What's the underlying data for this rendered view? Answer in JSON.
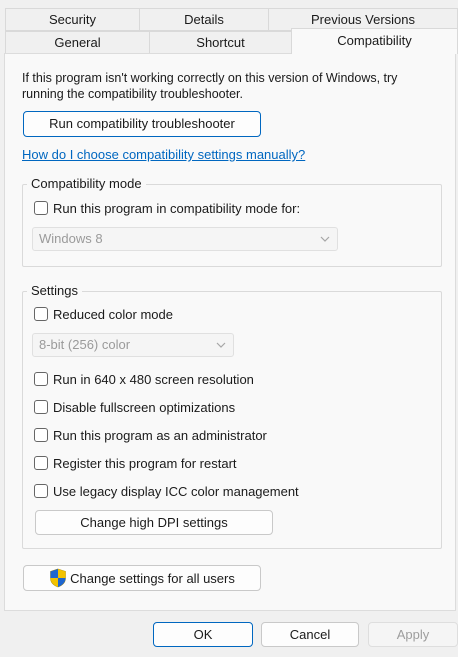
{
  "tabs_row1": [
    {
      "label": "Security"
    },
    {
      "label": "Details"
    },
    {
      "label": "Previous Versions"
    }
  ],
  "tabs_row2": [
    {
      "label": "General"
    },
    {
      "label": "Shortcut"
    },
    {
      "label": "Compatibility",
      "active": true
    }
  ],
  "intro": {
    "line1": "If this program isn't working correctly on this version of Windows, try",
    "line2": "running the compatibility troubleshooter."
  },
  "troubleshooter_button": "Run compatibility troubleshooter",
  "help_link": "How do I choose compatibility settings manually?",
  "compat_mode": {
    "legend": "Compatibility mode",
    "checkbox_label": "Run this program in compatibility mode for:",
    "checked": false,
    "os_select": "Windows 8"
  },
  "settings": {
    "legend": "Settings",
    "reduced_color": {
      "label": "Reduced color mode",
      "checked": false
    },
    "color_select": "8-bit (256) color",
    "options": [
      {
        "label": "Run in 640 x 480 screen resolution",
        "checked": false
      },
      {
        "label": "Disable fullscreen optimizations",
        "checked": false
      },
      {
        "label": "Run this program as an administrator",
        "checked": false
      },
      {
        "label": "Register this program for restart",
        "checked": false
      },
      {
        "label": "Use legacy display ICC color management",
        "checked": false
      }
    ],
    "dpi_button": "Change high DPI settings"
  },
  "all_users_button": {
    "label": "Change settings for all users",
    "icon": "uac-shield-icon"
  },
  "footer": {
    "ok": "OK",
    "cancel": "Cancel",
    "apply": "Apply",
    "apply_disabled": true
  },
  "colors": {
    "accent": "#0067c0",
    "link": "#0067c0",
    "panel": "#f9f9f9",
    "window": "#f0f0f0"
  }
}
